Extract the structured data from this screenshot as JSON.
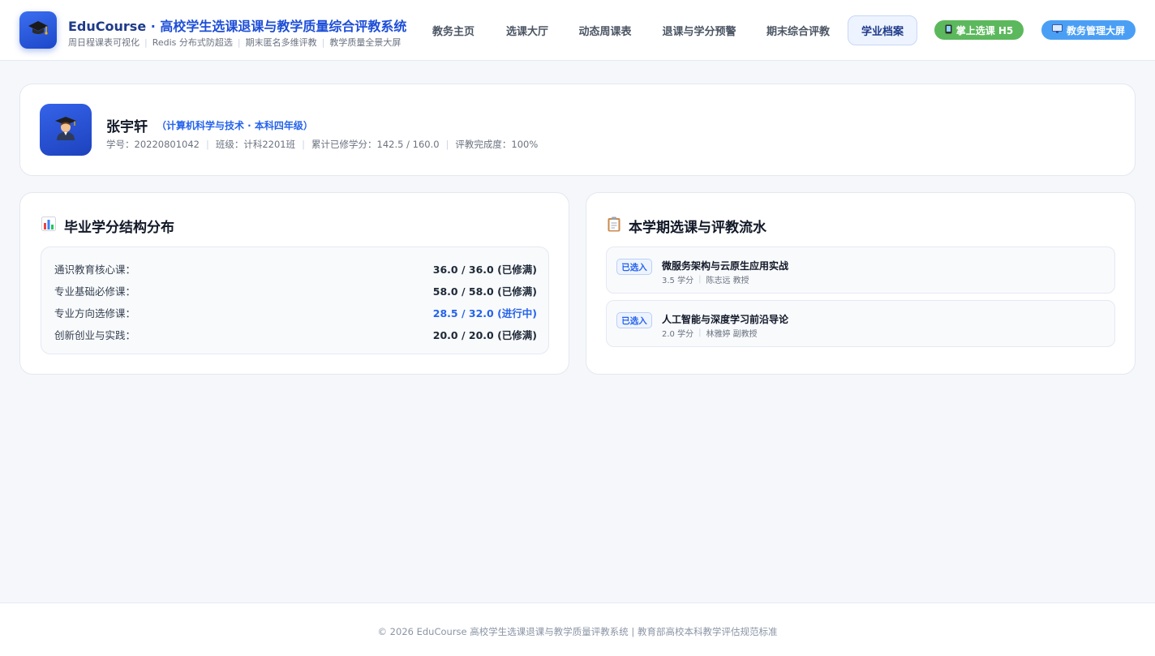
{
  "header": {
    "brand_en": "EduCourse",
    "brand_sep": " · ",
    "brand_cn": "高校学生选课退课与教学质量综合评教系统",
    "features": [
      "周日程课表可视化",
      "Redis 分布式防超选",
      "期末匿名多维评教",
      "教学质量全景大屏"
    ],
    "logo_icon": "graduation-cap-icon",
    "nav": [
      "教务主页",
      "选课大厅",
      "动态周课表",
      "退课与学分预警",
      "期末综合评教",
      "学业档案"
    ],
    "active_nav": "学业档案",
    "h5_button": "掌上选课 H5",
    "screen_button": "教务管理大屏"
  },
  "profile": {
    "name": "张宇轩",
    "major": "（计算机科学与技术 · 本科四年级）",
    "student_id": "学号：20220801042",
    "class": "班级：计科2201班",
    "credits": "累计已修学分：142.5 / 160.0",
    "eval_completion": "评教完成度：100%",
    "avatar_icon": "student-avatar-icon"
  },
  "credit_panel": {
    "title": "毕业学分结构分布",
    "icon": "bar-chart-icon",
    "rows": [
      {
        "label": "通识教育核心课：",
        "value": "36.0 / 36.0 (已修满)",
        "status": "done"
      },
      {
        "label": "专业基础必修课：",
        "value": "58.0 / 58.0 (已修满)",
        "status": "done"
      },
      {
        "label": "专业方向选修课：",
        "value": "28.5 / 32.0 (进行中)",
        "status": "progress"
      },
      {
        "label": "创新创业与实践：",
        "value": "20.0 / 20.0 (已修满)",
        "status": "done"
      }
    ]
  },
  "course_panel": {
    "title": "本学期选课与评教流水",
    "icon": "clipboard-icon",
    "items": [
      {
        "badge": "已选入",
        "name": "微服务架构与云原生应用实战",
        "credit": "3.5 学分",
        "teacher": "陈志远 教授"
      },
      {
        "badge": "已选入",
        "name": "人工智能与深度学习前沿导论",
        "credit": "2.0 学分",
        "teacher": "林雅婷 副教授"
      }
    ]
  },
  "footer": {
    "text": "© 2026 EduCourse 高校学生选课退课与教学质量评教系统 | 教育部高校本科教学评估规范标准"
  },
  "colors": {
    "primary": "#1d4ed8",
    "accent_blue": "#2563eb",
    "green_button": "#5cb85c",
    "blue_button": "#4a9ff5",
    "page_bg": "#f5f7fb"
  }
}
